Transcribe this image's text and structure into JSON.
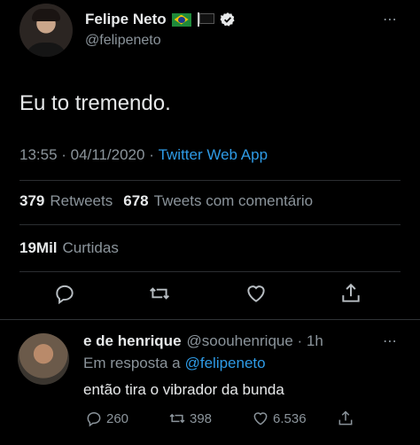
{
  "tweet": {
    "display_name": "Felipe Neto",
    "handle": "@felipeneto",
    "more_icon": "⋯",
    "text": "Eu to tremendo.",
    "time": "13:55 · 04/11/2020 · ",
    "source": "Twitter Web App",
    "retweets_count": "379",
    "retweets_label": "Retweets",
    "quotes_count": "678",
    "quotes_label": "Tweets com comentário",
    "likes_count": "19Mil",
    "likes_label": "Curtidas",
    "icons": [
      "reply-icon",
      "retweet-icon",
      "like-icon",
      "share-icon"
    ]
  },
  "reply": {
    "display_name": "e de henrique",
    "handle_time": "@soouhenrique · 1h",
    "more_icon": "⋯",
    "reply_to_label": "Em resposta a",
    "reply_to_mention": "@felipeneto",
    "text": "então tira o vibrador da bunda",
    "reply_count": "260",
    "retweet_count": "398",
    "like_count": "6.536"
  },
  "colors": {
    "background": "#000000",
    "text": "#e7e9ea",
    "muted": "#8b949b",
    "link": "#2e9be6",
    "divider": "#2b2e31"
  }
}
